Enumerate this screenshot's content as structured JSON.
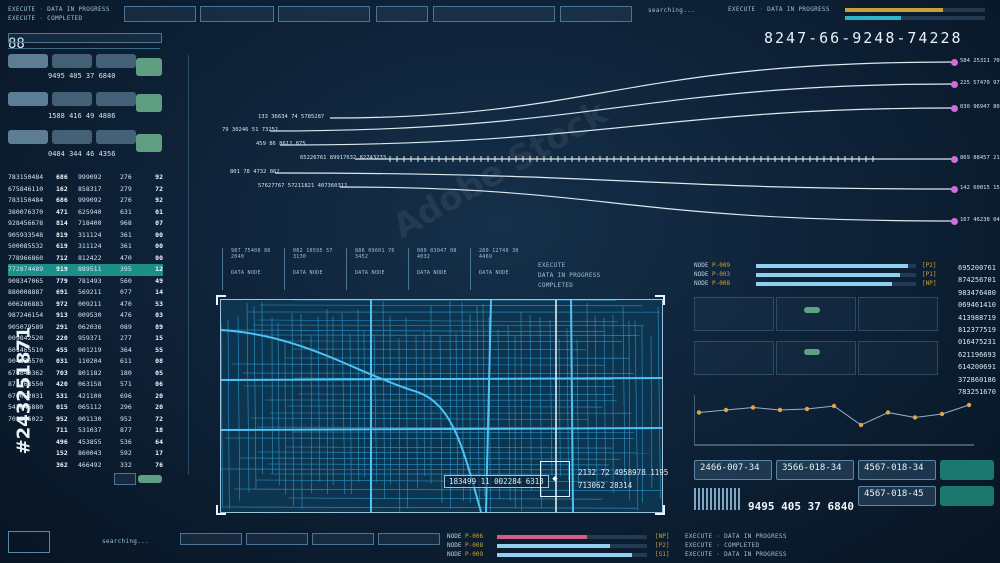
{
  "top_code": "8247-66-9248-74228",
  "top_counter": "88",
  "status_lines": [
    {
      "label": "EXECUTE",
      "progress": "DATA IN PROGRESS",
      "state": "COMPLETED"
    },
    {
      "label": "EXECUTE",
      "progress": "DATA IN PROGRESS",
      "state": "COMPLETED"
    },
    {
      "label": "EXECUTE",
      "progress": "DATA IN PROGRESS",
      "state": "COMPLETED"
    }
  ],
  "left_tiles": [
    {
      "code": "9495 405 37 6840"
    },
    {
      "code": "1588 416 49 4886"
    },
    {
      "code": "0484 344 46 4356"
    }
  ],
  "left_table": [
    [
      "783150484",
      "686",
      "999092",
      "276",
      "92"
    ],
    [
      "675846110",
      "162",
      "858317",
      "279",
      "72"
    ],
    [
      "783150484",
      "686",
      "999092",
      "276",
      "92"
    ],
    [
      "380076370",
      "471",
      "625940",
      "631",
      "01"
    ],
    [
      "928456678",
      "814",
      "718400",
      "968",
      "07"
    ],
    [
      "905933548",
      "819",
      "311124",
      "361",
      "00"
    ],
    [
      "500085532",
      "619",
      "311124",
      "361",
      "00"
    ],
    [
      "778966860",
      "712",
      "812422",
      "470",
      "00"
    ],
    [
      "772874489",
      "919",
      "889511",
      "395",
      "12"
    ],
    [
      "908347065",
      "779",
      "781493",
      "560",
      "49"
    ],
    [
      "880008887",
      "691",
      "569211",
      "077",
      "14"
    ],
    [
      "606286883",
      "972",
      "009211",
      "470",
      "53"
    ],
    [
      "987246154",
      "913",
      "009530",
      "476",
      "03"
    ],
    [
      "905079589",
      "291",
      "062036",
      "089",
      "89"
    ],
    [
      "009842520",
      "220",
      "959371",
      "277",
      "15"
    ],
    [
      "601465510",
      "455",
      "001219",
      "364",
      "55"
    ],
    [
      "904876570",
      "031",
      "110204",
      "611",
      "08"
    ],
    [
      "670840362",
      "703",
      "801182",
      "180",
      "05"
    ],
    [
      "873268550",
      "420",
      "063158",
      "571",
      "06"
    ],
    [
      "070052031",
      "531",
      "421100",
      "696",
      "20"
    ],
    [
      "543846880",
      "015",
      "065112",
      "296",
      "20"
    ],
    [
      "701205022",
      "952",
      "001130",
      "952",
      "72"
    ],
    [
      "",
      "711",
      "531037",
      "877",
      "18"
    ],
    [
      "",
      "496",
      "453855",
      "536",
      "64"
    ],
    [
      "",
      "152",
      "860043",
      "592",
      "17"
    ],
    [
      "",
      "362",
      "466492",
      "332",
      "76"
    ]
  ],
  "connector_lines": [
    {
      "left": "133 36634 74 5785287",
      "right": "584 25311 70"
    },
    {
      "left": "79 30246 51 73251",
      "right": "225 57470 97"
    },
    {
      "left": "459 86 8612 875",
      "right": "030 96947 80"
    },
    {
      "left": "65226761 89917632 82743233",
      "right": "869 88457 21"
    },
    {
      "left": "801 78 4732 862",
      "right": "142 60015 15"
    },
    {
      "left": "57627767 57211821 407360311",
      "right": "167 46238 04"
    }
  ],
  "data_nodes": [
    {
      "id": "987 75408 86 2040",
      "label": "DATA NODE"
    },
    {
      "id": "082 10595 57 3130",
      "label": "DATA NODE"
    },
    {
      "id": "886 09601 76 3452",
      "label": "DATA NODE"
    },
    {
      "id": "080 03047 08 4032",
      "label": "DATA NODE"
    },
    {
      "id": "280 12740 30 4469",
      "label": "DATA NODE"
    }
  ],
  "nodes_right": [
    {
      "name": "NODE",
      "code": "P-009",
      "tag": "[P2]",
      "fill": 0.95
    },
    {
      "name": "NODE",
      "code": "P-003",
      "tag": "[P1]",
      "fill": 0.9
    },
    {
      "name": "NODE",
      "code": "P-008",
      "tag": "[NP]",
      "fill": 0.85
    }
  ],
  "right_numbers": [
    "695200761",
    "874256701",
    "983476480",
    "069461410",
    "413988719",
    "812377519",
    "016475231",
    "621196693",
    "614200691",
    "372860186",
    "783251670"
  ],
  "map_readouts": {
    "row1": "2132  72  4958978  1195",
    "row2": "183499  11  002284  6313",
    "row3": "713062  28314"
  },
  "bottom_codes": [
    {
      "code": "2466-007-34"
    },
    {
      "code": "3566-018-34"
    },
    {
      "code": "4567-018-34"
    },
    {
      "code": "4567-018-45"
    }
  ],
  "big_code": "9495 405 37 6840",
  "bottom_nodes": [
    {
      "name": "NODE",
      "code": "P-006",
      "tag": "[NP]"
    },
    {
      "name": "NODE",
      "code": "P-008",
      "tag": "[P2]"
    },
    {
      "name": "NODE",
      "code": "P-009",
      "tag": "[S1]"
    }
  ],
  "searching": "searching...",
  "watermark": "Adobe Stock",
  "stock_id": "#243251871",
  "chart_points": [
    0.35,
    0.3,
    0.25,
    0.3,
    0.28,
    0.22,
    0.6,
    0.35,
    0.45,
    0.38,
    0.2
  ]
}
